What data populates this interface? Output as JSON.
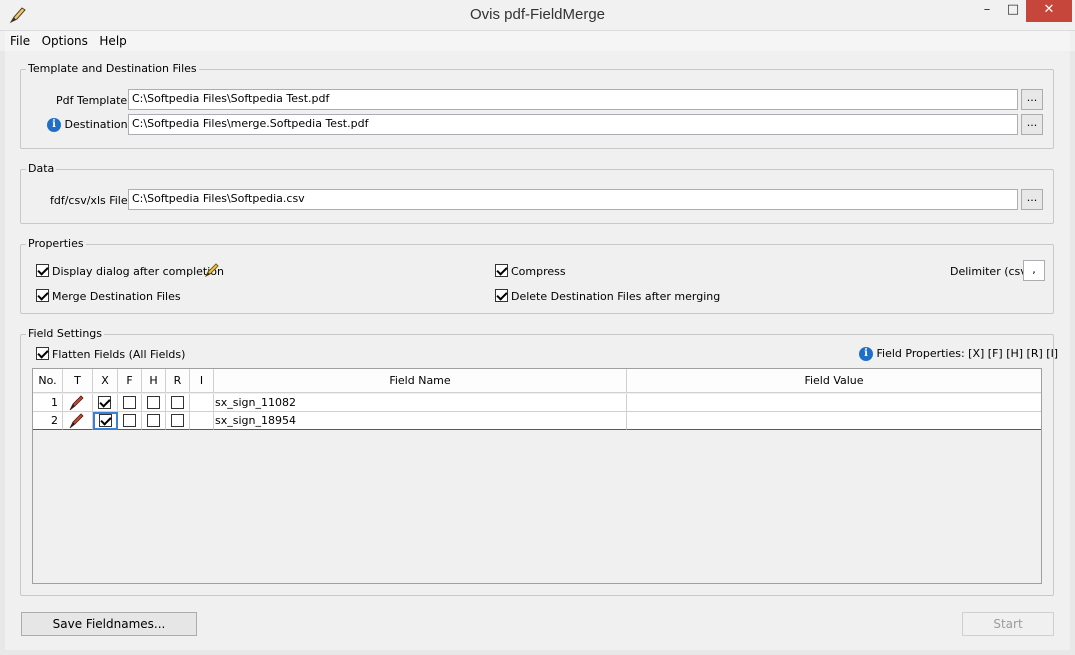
{
  "window": {
    "title": "Ovis pdf-FieldMerge",
    "minimize": "–",
    "maximize": "□",
    "close": "✕"
  },
  "menu": [
    "File",
    "Options",
    "Help"
  ],
  "template_group": {
    "title": "Template and Destination Files",
    "pdf_template_label": "Pdf Template:",
    "pdf_template_value": "C:\\Softpedia Files\\Softpedia Test.pdf",
    "destination_label": "Destination:",
    "destination_value": "C:\\Softpedia Files\\merge.Softpedia Test.pdf",
    "browse": "..."
  },
  "data_group": {
    "title": "Data",
    "file_label": "fdf/csv/xls File:",
    "file_value": "C:\\Softpedia Files\\Softpedia.csv",
    "browse": "..."
  },
  "properties_group": {
    "title": "Properties",
    "display_dialog": {
      "label": "Display dialog after completion",
      "checked": true
    },
    "merge_destination": {
      "label": "Merge Destination Files",
      "checked": true
    },
    "compress": {
      "label": "Compress",
      "checked": true
    },
    "delete_destination": {
      "label": "Delete Destination Files after merging",
      "checked": true
    },
    "delimiter_label": "Delimiter (csv):",
    "delimiter_value": ","
  },
  "field_settings": {
    "title": "Field Settings",
    "flatten": {
      "label": "Flatten Fields (All Fields)",
      "checked": true
    },
    "field_properties": "Field Properties: [X] [F] [H] [R] [I]",
    "columns": [
      "No.",
      "T",
      "X",
      "F",
      "H",
      "R",
      "I",
      "Field Name",
      "Field Value"
    ],
    "rows": [
      {
        "no": "1",
        "x": true,
        "f": false,
        "h": false,
        "r": false,
        "name": "sx_sign_11082",
        "value": ""
      },
      {
        "no": "2",
        "x": true,
        "f": false,
        "h": false,
        "r": false,
        "name": "sx_sign_18954",
        "value": ""
      }
    ]
  },
  "buttons": {
    "save_fieldnames": "Save Fieldnames...",
    "start": "Start"
  },
  "icons": {
    "info": "i"
  },
  "colors": {
    "close_button": "#c7463c",
    "info_icon": "#1f6fc9"
  }
}
